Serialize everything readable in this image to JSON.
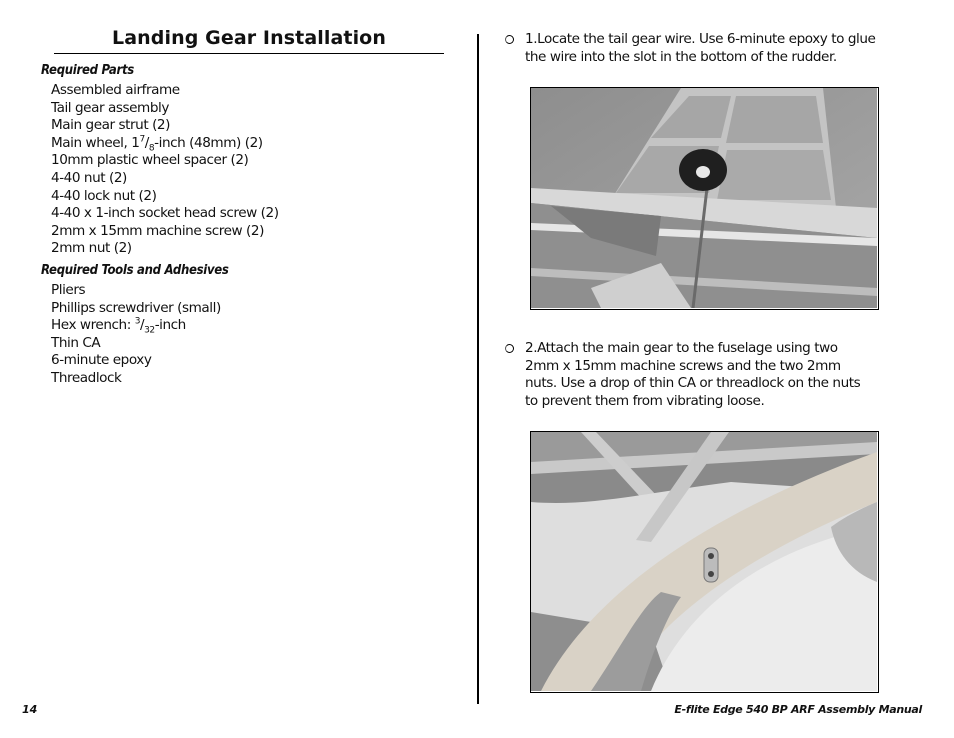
{
  "page": {
    "title": "Landing Gear Installation",
    "page_number": "14",
    "manual_title": "E-flite Edge 540 BP ARF Assembly Manual"
  },
  "required_parts": {
    "heading": "Required Parts",
    "items": [
      {
        "text": "Assembled airframe"
      },
      {
        "text": "Tail gear assembly"
      },
      {
        "text": "Main gear strut (2)"
      },
      {
        "pre": "Main wheel, 1",
        "num": "7",
        "den": "8",
        "post": "-inch (48mm) (2)"
      },
      {
        "text": "10mm plastic wheel spacer (2)"
      },
      {
        "text": "4-40 nut (2)"
      },
      {
        "text": "4-40 lock nut (2)"
      },
      {
        "text": "4-40 x 1-inch socket head screw (2)"
      },
      {
        "text": "2mm x 15mm machine screw (2)"
      },
      {
        "text": "2mm nut (2)"
      }
    ]
  },
  "required_tools": {
    "heading": "Required Tools and Adhesives",
    "items": [
      {
        "text": "Pliers"
      },
      {
        "text": "Phillips screwdriver (small)"
      },
      {
        "pre": "Hex wrench: ",
        "num": "3",
        "den": "32",
        "post": "-inch"
      },
      {
        "text": "Thin CA"
      },
      {
        "text": "6-minute epoxy"
      },
      {
        "text": "Threadlock"
      }
    ]
  },
  "steps": [
    {
      "text": "1.Locate the tail gear wire. Use 6-minute epoxy to glue the wire into the slot in the bottom of the rudder.",
      "checked": false,
      "photo": "Tail gear wire with small wheel glued into rudder slot, viewed from below"
    },
    {
      "text": "2.Attach the main gear to the fuselage using two 2mm x 15mm machine screws and the two 2mm nuts. Use a drop of thin CA or threadlock on the nuts to prevent them from vibrating loose.",
      "checked": false,
      "photo": "Main gear strut attached to balsa fuselage side with two screws"
    }
  ]
}
